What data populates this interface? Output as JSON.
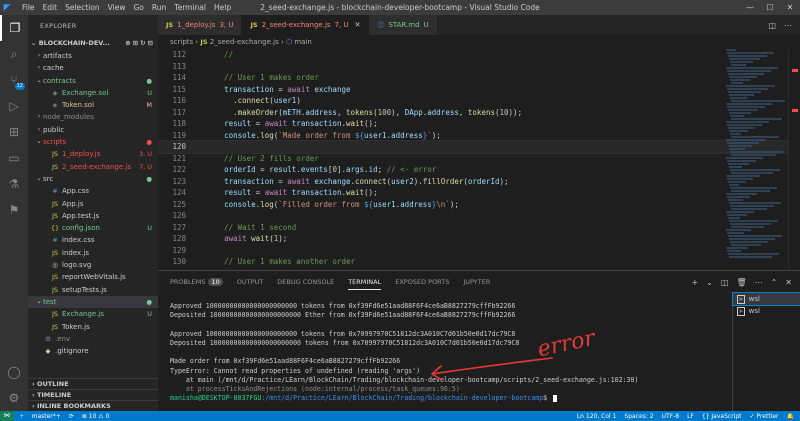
{
  "window": {
    "title": "2_seed-exchange.js - blockchain-developer-bootcamp - Visual Studio Code",
    "menu": [
      "File",
      "Edit",
      "Selection",
      "View",
      "Go",
      "Run",
      "Terminal",
      "Help"
    ]
  },
  "activity": {
    "scm_badge": "12"
  },
  "explorer": {
    "title": "EXPLORER",
    "project": "BLOCKCHAIN-DEV...",
    "tree": [
      {
        "depth": 1,
        "chev": "›",
        "icon": "",
        "icon_color": "",
        "label": "artifacts",
        "status": "",
        "label_color": "",
        "status_color": ""
      },
      {
        "depth": 1,
        "chev": "›",
        "icon": "",
        "icon_color": "",
        "label": "cache",
        "status": "",
        "label_color": "",
        "status_color": ""
      },
      {
        "depth": 1,
        "chev": "⌄",
        "icon": "",
        "icon_color": "",
        "label": "contracts",
        "status": "●",
        "label_color": "green",
        "status_color": "green"
      },
      {
        "depth": 2,
        "chev": "",
        "icon": "◈",
        "icon_color": "gray",
        "label": "Exchange.sol",
        "status": "U",
        "label_color": "green",
        "status_color": "green"
      },
      {
        "depth": 2,
        "chev": "",
        "icon": "◈",
        "icon_color": "gray",
        "label": "Token.sol",
        "status": "M",
        "label_color": "orange",
        "status_color": "orange"
      },
      {
        "depth": 1,
        "chev": "›",
        "icon": "",
        "icon_color": "",
        "label": "node_modules",
        "status": "",
        "label_color": "gray",
        "status_color": ""
      },
      {
        "depth": 1,
        "chev": "›",
        "icon": "",
        "icon_color": "",
        "label": "public",
        "status": "",
        "label_color": "",
        "status_color": ""
      },
      {
        "depth": 1,
        "chev": "⌄",
        "icon": "",
        "icon_color": "",
        "label": "scripts",
        "status": "●",
        "label_color": "red",
        "status_color": "red"
      },
      {
        "depth": 2,
        "chev": "",
        "icon": "JS",
        "icon_color": "yellow",
        "label": "1_deploy.js",
        "status": "3, U",
        "label_color": "red",
        "status_color": "red"
      },
      {
        "depth": 2,
        "chev": "",
        "icon": "JS",
        "icon_color": "yellow",
        "label": "2_seed-exchange.js",
        "status": "7, U",
        "label_color": "red",
        "status_color": "red"
      },
      {
        "depth": 1,
        "chev": "⌄",
        "icon": "",
        "icon_color": "",
        "label": "src",
        "status": "●",
        "label_color": "",
        "status_color": "green"
      },
      {
        "depth": 2,
        "chev": "",
        "icon": "#",
        "icon_color": "blue",
        "label": "App.css",
        "status": "",
        "label_color": "",
        "status_color": ""
      },
      {
        "depth": 2,
        "chev": "",
        "icon": "JS",
        "icon_color": "yellow",
        "label": "App.js",
        "status": "",
        "label_color": "",
        "status_color": ""
      },
      {
        "depth": 2,
        "chev": "",
        "icon": "JS",
        "icon_color": "yellow",
        "label": "App.test.js",
        "status": "",
        "label_color": "",
        "status_color": ""
      },
      {
        "depth": 2,
        "chev": "",
        "icon": "{}",
        "icon_color": "yellow",
        "label": "config.json",
        "status": "U",
        "label_color": "green",
        "status_color": "green"
      },
      {
        "depth": 2,
        "chev": "",
        "icon": "#",
        "icon_color": "blue",
        "label": "index.css",
        "status": "",
        "label_color": "",
        "status_color": ""
      },
      {
        "depth": 2,
        "chev": "",
        "icon": "JS",
        "icon_color": "yellow",
        "label": "index.js",
        "status": "",
        "label_color": "",
        "status_color": ""
      },
      {
        "depth": 2,
        "chev": "",
        "icon": "◎",
        "icon_color": "orange",
        "label": "logo.svg",
        "status": "",
        "label_color": "",
        "status_color": ""
      },
      {
        "depth": 2,
        "chev": "",
        "icon": "JS",
        "icon_color": "yellow",
        "label": "reportWebVitals.js",
        "status": "",
        "label_color": "",
        "status_color": ""
      },
      {
        "depth": 2,
        "chev": "",
        "icon": "JS",
        "icon_color": "yellow",
        "label": "setupTests.js",
        "status": "",
        "label_color": "",
        "status_color": ""
      },
      {
        "depth": 1,
        "chev": "⌄",
        "icon": "",
        "icon_color": "",
        "label": "test",
        "status": "●",
        "label_color": "green",
        "status_color": "green",
        "selected": true
      },
      {
        "depth": 2,
        "chev": "",
        "icon": "JS",
        "icon_color": "yellow",
        "label": "Exchange.js",
        "status": "U",
        "label_color": "green",
        "status_color": "green"
      },
      {
        "depth": 2,
        "chev": "",
        "icon": "JS",
        "icon_color": "yellow",
        "label": "Token.js",
        "status": "",
        "label_color": "",
        "status_color": ""
      },
      {
        "depth": 1,
        "chev": "",
        "icon": "⚙",
        "icon_color": "gray",
        "label": ".env",
        "status": "",
        "label_color": "gray",
        "status_color": ""
      },
      {
        "depth": 1,
        "chev": "",
        "icon": "◆",
        "icon_color": "orange",
        "label": ".gitignore",
        "status": "",
        "label_color": "",
        "status_color": ""
      }
    ],
    "sections": [
      "OUTLINE",
      "TIMELINE",
      "INLINE BOOKMARKS"
    ]
  },
  "tabs": [
    {
      "label": "1_deploy.js",
      "status": "3, U",
      "type": "js",
      "active": false
    },
    {
      "label": "2_seed-exchange.js",
      "status": "7, U",
      "type": "js",
      "active": true
    },
    {
      "label": "STAR.md",
      "status": "U",
      "type": "md",
      "active": false
    }
  ],
  "breadcrumb": {
    "folder": "scripts",
    "file": "2_seed-exchange.js",
    "symbol": "main"
  },
  "editor": {
    "current_line": 120,
    "lines": [
      {
        "n": 112,
        "segs": [
          [
            "    //",
            "c-com"
          ]
        ]
      },
      {
        "n": 113,
        "segs": [
          [
            "",
            ""
          ]
        ]
      },
      {
        "n": 114,
        "segs": [
          [
            "    // User 1 makes order",
            "c-com"
          ]
        ]
      },
      {
        "n": 115,
        "segs": [
          [
            "    ",
            ""
          ],
          [
            "transaction",
            "c-var"
          ],
          [
            " = ",
            ""
          ],
          [
            "await",
            "c-ctl"
          ],
          [
            " ",
            ""
          ],
          [
            "exchange",
            "c-var"
          ]
        ]
      },
      {
        "n": 116,
        "segs": [
          [
            "      .",
            ""
          ],
          [
            "connect",
            "c-fn"
          ],
          [
            "(",
            ""
          ],
          [
            "user1",
            "c-var"
          ],
          [
            ")",
            ""
          ]
        ]
      },
      {
        "n": 117,
        "segs": [
          [
            "      .",
            ""
          ],
          [
            "makeOrder",
            "c-fn"
          ],
          [
            "(",
            ""
          ],
          [
            "mETH",
            "c-var"
          ],
          [
            ".",
            ""
          ],
          [
            "address",
            "c-var"
          ],
          [
            ", ",
            ""
          ],
          [
            "tokens",
            "c-fn"
          ],
          [
            "(",
            ""
          ],
          [
            "100",
            "c-num"
          ],
          [
            "), ",
            ""
          ],
          [
            "DApp",
            "c-var"
          ],
          [
            ".",
            ""
          ],
          [
            "address",
            "c-var"
          ],
          [
            ", ",
            ""
          ],
          [
            "tokens",
            "c-fn"
          ],
          [
            "(",
            ""
          ],
          [
            "10",
            "c-num"
          ],
          [
            "));",
            ""
          ]
        ]
      },
      {
        "n": 118,
        "segs": [
          [
            "    ",
            ""
          ],
          [
            "result",
            "c-var"
          ],
          [
            " = ",
            ""
          ],
          [
            "await",
            "c-ctl"
          ],
          [
            " ",
            ""
          ],
          [
            "transaction",
            "c-var"
          ],
          [
            ".",
            ""
          ],
          [
            "wait",
            "c-fn"
          ],
          [
            "();",
            ""
          ]
        ]
      },
      {
        "n": 119,
        "segs": [
          [
            "    ",
            ""
          ],
          [
            "console",
            "c-var"
          ],
          [
            ".",
            ""
          ],
          [
            "log",
            "c-fn"
          ],
          [
            "(",
            ""
          ],
          [
            "`Made order from ",
            "c-str"
          ],
          [
            "${",
            "c-kw"
          ],
          [
            "user1",
            "c-var"
          ],
          [
            ".",
            ""
          ],
          [
            "address",
            "c-var"
          ],
          [
            "}",
            "c-kw"
          ],
          [
            "`",
            "c-str"
          ],
          [
            ");",
            ""
          ]
        ]
      },
      {
        "n": 120,
        "segs": [
          [
            "",
            ""
          ]
        ]
      },
      {
        "n": 121,
        "segs": [
          [
            "    // User 2 fills order",
            "c-com"
          ]
        ]
      },
      {
        "n": 122,
        "segs": [
          [
            "    ",
            ""
          ],
          [
            "orderId",
            "c-var"
          ],
          [
            " = ",
            ""
          ],
          [
            "result",
            "c-var"
          ],
          [
            ".",
            ""
          ],
          [
            "events",
            "c-var"
          ],
          [
            "[",
            ""
          ],
          [
            "0",
            "c-num"
          ],
          [
            "].",
            ""
          ],
          [
            "args",
            "c-var"
          ],
          [
            ".",
            ""
          ],
          [
            "id",
            "c-var"
          ],
          [
            "; ",
            ""
          ],
          [
            "// <- error",
            "c-com"
          ]
        ]
      },
      {
        "n": 123,
        "segs": [
          [
            "    ",
            ""
          ],
          [
            "transaction",
            "c-var"
          ],
          [
            " = ",
            ""
          ],
          [
            "await",
            "c-ctl"
          ],
          [
            " ",
            ""
          ],
          [
            "exchange",
            "c-var"
          ],
          [
            ".",
            ""
          ],
          [
            "connect",
            "c-fn"
          ],
          [
            "(",
            ""
          ],
          [
            "user2",
            "c-var"
          ],
          [
            ").",
            ""
          ],
          [
            "fillOrder",
            "c-fn"
          ],
          [
            "(",
            ""
          ],
          [
            "orderId",
            "c-var"
          ],
          [
            ");",
            ""
          ]
        ]
      },
      {
        "n": 124,
        "segs": [
          [
            "    ",
            ""
          ],
          [
            "result",
            "c-var"
          ],
          [
            " = ",
            ""
          ],
          [
            "await",
            "c-ctl"
          ],
          [
            " ",
            ""
          ],
          [
            "transaction",
            "c-var"
          ],
          [
            ".",
            ""
          ],
          [
            "wait",
            "c-fn"
          ],
          [
            "();",
            ""
          ]
        ]
      },
      {
        "n": 125,
        "segs": [
          [
            "    ",
            ""
          ],
          [
            "console",
            "c-var"
          ],
          [
            ".",
            ""
          ],
          [
            "log",
            "c-fn"
          ],
          [
            "(",
            ""
          ],
          [
            "`Filled order from ",
            "c-str"
          ],
          [
            "${",
            "c-kw"
          ],
          [
            "user1",
            "c-var"
          ],
          [
            ".",
            ""
          ],
          [
            "address",
            "c-var"
          ],
          [
            "}",
            "c-kw"
          ],
          [
            "\\n`",
            "c-str"
          ],
          [
            ");",
            ""
          ]
        ]
      },
      {
        "n": 126,
        "segs": [
          [
            "",
            ""
          ]
        ]
      },
      {
        "n": 127,
        "segs": [
          [
            "    // Wait 1 second",
            "c-com"
          ]
        ]
      },
      {
        "n": 128,
        "segs": [
          [
            "    ",
            ""
          ],
          [
            "await",
            "c-ctl"
          ],
          [
            " ",
            ""
          ],
          [
            "wait",
            "c-fn"
          ],
          [
            "(",
            ""
          ],
          [
            "1",
            "c-num"
          ],
          [
            ");",
            ""
          ]
        ]
      },
      {
        "n": 129,
        "segs": [
          [
            "",
            ""
          ]
        ]
      },
      {
        "n": 130,
        "segs": [
          [
            "    // User 1 makes another order",
            "c-com"
          ]
        ]
      }
    ]
  },
  "panel": {
    "tabs": [
      {
        "label": "PROBLEMS",
        "count": "10",
        "active": false
      },
      {
        "label": "OUTPUT",
        "count": "",
        "active": false
      },
      {
        "label": "DEBUG CONSOLE",
        "count": "",
        "active": false
      },
      {
        "label": "TERMINAL",
        "count": "",
        "active": true
      },
      {
        "label": "EXPOSED PORTS",
        "count": "",
        "active": false
      },
      {
        "label": "JUPYTER",
        "count": "",
        "active": false
      }
    ],
    "terminal_lines": [
      {
        "text": "",
        "cls": ""
      },
      {
        "text": "Approved 10000000000000000000000 tokens from 0xf39Fd6e51aad88F6F4ce6aB8827279cffFb92266",
        "cls": ""
      },
      {
        "text": "Deposited 10000000000000000000000 Ether from 0xf39Fd6e51aad88F6F4ce6aB8827279cffFb92266",
        "cls": ""
      },
      {
        "text": "",
        "cls": ""
      },
      {
        "text": "Approved 10000000000000000000000 tokens from 0x70997970C51812dc3A010C7d01b50e0d17dc79C8",
        "cls": ""
      },
      {
        "text": "Deposited 10000000000000000000000 tokens from 0x70997970C51812dc3A010C7d01b50e0d17dc79C8",
        "cls": ""
      },
      {
        "text": "",
        "cls": ""
      },
      {
        "text": "Made order from 0xf39Fd6e51aad88F6F4ce6aB8827279cffFb92266",
        "cls": ""
      },
      {
        "text": "TypeError: Cannot read properties of undefined (reading 'args')",
        "cls": ""
      },
      {
        "text": "    at main (/mnt/d/Practice/LEarn/BlockChain/Trading/blockchain-developer-bootcamp/scripts/2_seed-exchange.js:102:30)",
        "cls": ""
      },
      {
        "text": "    at processTicksAndRejections (node:internal/process/task_queues:96:5)",
        "cls": "dim"
      }
    ],
    "prompt_user": "manisha@DESKTOP-8037FGU",
    "prompt_path": ":/mnt/d/Practice/LEarn/BlockChain/Trading/blockchain-developer-bootcamp",
    "prompt_symbol": "$",
    "terminals": [
      {
        "label": "wsl",
        "selected": true
      },
      {
        "label": "wsl",
        "selected": false
      }
    ]
  },
  "annotation": {
    "text": "error",
    "color": "#e53935"
  },
  "statusbar": {
    "remote": "⋈",
    "branch": "master*+",
    "sync": "⟳",
    "problems": "⊗ 10  ⚠ 0",
    "position": "Ln 120, Col 1",
    "spaces": "Spaces: 2",
    "encoding": "UTF-8",
    "eol": "LF",
    "language": "{} JavaScript",
    "prettier": "✓ Prettier"
  }
}
